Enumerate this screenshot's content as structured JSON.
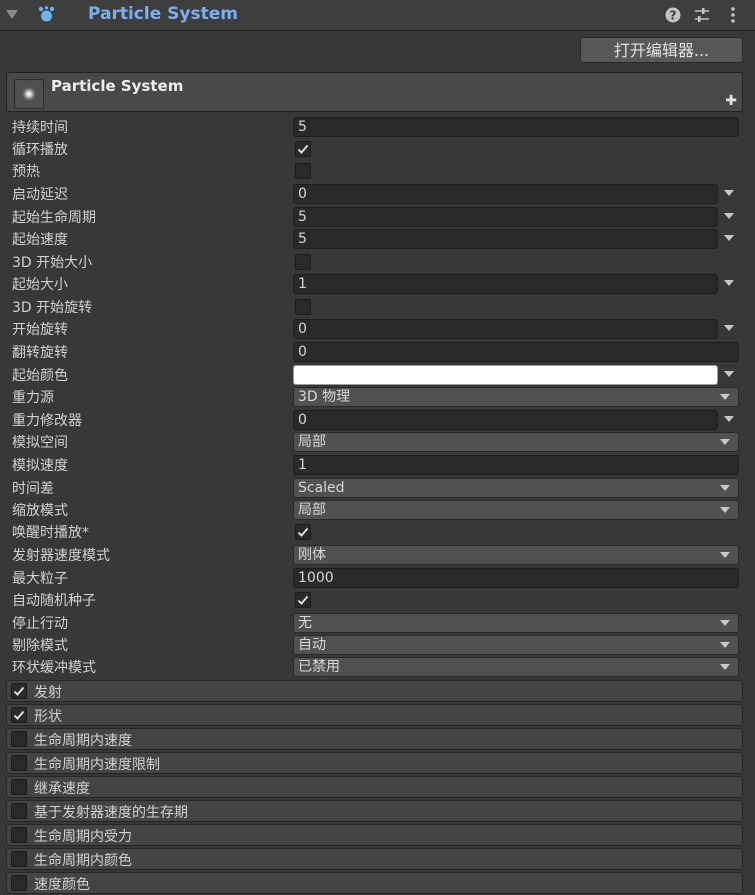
{
  "header": {
    "title": "Particle System",
    "help_icon": "help-icon",
    "preset_icon": "preset-icon",
    "menu_icon": "kebab-menu-icon"
  },
  "open_editor_label": "打开编辑器...",
  "main_module": {
    "title": "Particle System",
    "add_icon": "plus-icon"
  },
  "properties": {
    "duration": {
      "label": "持续时间",
      "value": "5"
    },
    "looping": {
      "label": "循环播放",
      "checked": true
    },
    "prewarm": {
      "label": "预热",
      "checked": false
    },
    "start_delay": {
      "label": "启动延迟",
      "value": "0"
    },
    "start_lifetime": {
      "label": "起始生命周期",
      "value": "5"
    },
    "start_speed": {
      "label": "起始速度",
      "value": "5"
    },
    "start_size_3d": {
      "label": "3D 开始大小",
      "checked": false
    },
    "start_size": {
      "label": "起始大小",
      "value": "1"
    },
    "start_rotation_3d": {
      "label": "3D 开始旋转",
      "checked": false
    },
    "start_rotation": {
      "label": "开始旋转",
      "value": "0"
    },
    "flip_rotation": {
      "label": "翻转旋转",
      "value": "0"
    },
    "start_color": {
      "label": "起始颜色",
      "color": "#ffffff"
    },
    "gravity_source": {
      "label": "重力源",
      "value": "3D 物理"
    },
    "gravity_modifier": {
      "label": "重力修改器",
      "value": "0"
    },
    "simulation_space": {
      "label": "模拟空间",
      "value": "局部"
    },
    "simulation_speed": {
      "label": "模拟速度",
      "value": "1"
    },
    "delta_time": {
      "label": "时间差",
      "value": "Scaled"
    },
    "scaling_mode": {
      "label": "缩放模式",
      "value": "局部"
    },
    "play_on_awake": {
      "label": "唤醒时播放*",
      "checked": true
    },
    "emitter_velocity_mode": {
      "label": "发射器速度模式",
      "value": "刚体"
    },
    "max_particles": {
      "label": "最大粒子",
      "value": "1000"
    },
    "auto_random_seed": {
      "label": "自动随机种子",
      "checked": true
    },
    "stop_action": {
      "label": "停止行动",
      "value": "无"
    },
    "culling_mode": {
      "label": "剔除模式",
      "value": "自动"
    },
    "ring_buffer_mode": {
      "label": "环状缓冲模式",
      "value": "已禁用"
    }
  },
  "modules": [
    {
      "label": "发射",
      "enabled": true
    },
    {
      "label": "形状",
      "enabled": true
    },
    {
      "label": "生命周期内速度",
      "enabled": false
    },
    {
      "label": "生命周期内速度限制",
      "enabled": false
    },
    {
      "label": "继承速度",
      "enabled": false
    },
    {
      "label": "基于发射器速度的生存期",
      "enabled": false
    },
    {
      "label": "生命周期内受力",
      "enabled": false
    },
    {
      "label": "生命周期内颜色",
      "enabled": false
    },
    {
      "label": "速度颜色",
      "enabled": false
    }
  ],
  "colors": {
    "title_accent": "#7bb0ee",
    "panel_bg": "#383838",
    "field_bg": "#2a2a2a",
    "dropdown_bg": "#515151"
  }
}
